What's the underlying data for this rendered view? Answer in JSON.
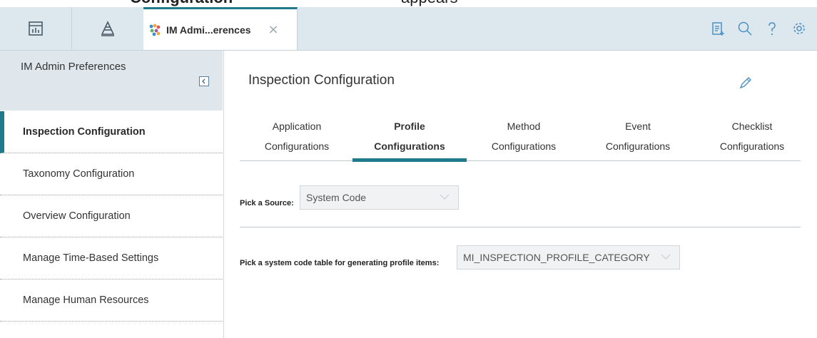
{
  "caption": {
    "word": "Configuration",
    "tail": "appears"
  },
  "topbar": {
    "active_tab_title": "IM Admi...erences",
    "close_symbol": "×",
    "icons": [
      "home-dashboard-icon",
      "launcher-icon",
      "tab-app-icon",
      "clipboard-icon",
      "search-icon",
      "help-icon",
      "settings-gear-icon"
    ]
  },
  "sidebar": {
    "title": "IM Admin Preferences",
    "items": [
      {
        "label": "Inspection Configuration",
        "active": true
      },
      {
        "label": "Taxonomy Configuration",
        "active": false
      },
      {
        "label": "Overview Configuration",
        "active": false
      },
      {
        "label": "Manage Time-Based Settings",
        "active": false
      },
      {
        "label": "Manage Human Resources",
        "active": false
      }
    ]
  },
  "main": {
    "title": "Inspection Configuration",
    "tabs": [
      {
        "line1": "Application",
        "line2": "Configurations",
        "active": false
      },
      {
        "line1": "Profile",
        "line2": "Configurations",
        "active": true
      },
      {
        "line1": "Method",
        "line2": "Configurations",
        "active": false
      },
      {
        "line1": "Event",
        "line2": "Configurations",
        "active": false
      },
      {
        "line1": "Checklist",
        "line2": "Configurations",
        "active": false
      }
    ],
    "source": {
      "label": "Pick a Source:",
      "value": "System Code"
    },
    "code_table": {
      "label": "Pick a system code table for generating profile items:",
      "value": "MI_INSPECTION_PROFILE_CATEGORY"
    }
  },
  "colors": {
    "accent": "#1f7a8c",
    "topbar_bg": "#dde7ee",
    "sidebar_header_bg": "#dfe6ec",
    "icon_blue": "#4a90c2"
  }
}
